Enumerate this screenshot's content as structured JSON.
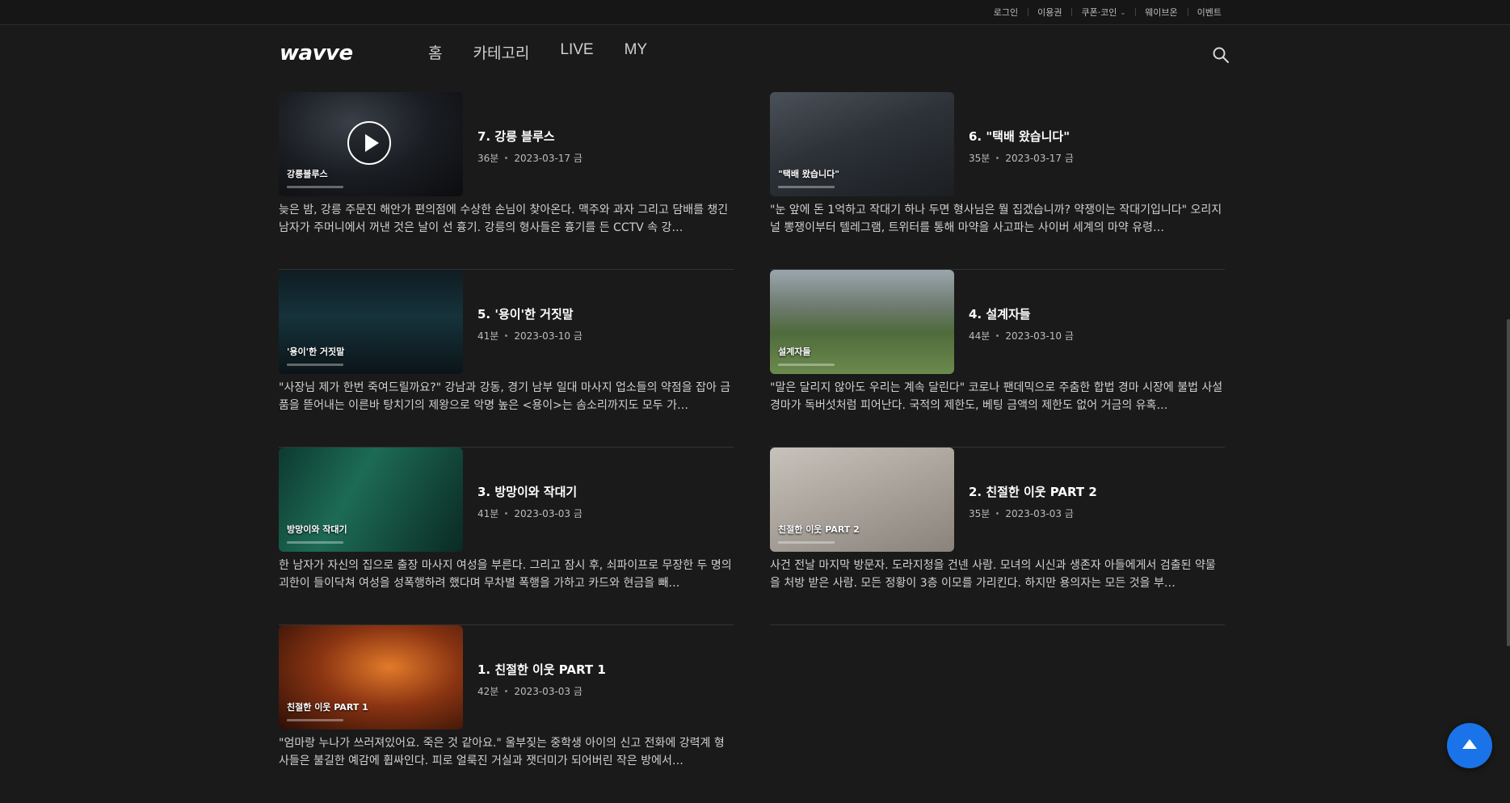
{
  "top_links": [
    {
      "label": "로그인"
    },
    {
      "label": "이용권"
    },
    {
      "label": "쿠폰·코인",
      "has_dropdown": true
    },
    {
      "label": "웨이브온"
    },
    {
      "label": "이벤트"
    }
  ],
  "brand": {
    "logo_text": "wavve"
  },
  "nav": {
    "items": [
      {
        "label": "홈"
      },
      {
        "label": "카테고리"
      },
      {
        "label": "LIVE"
      },
      {
        "label": "MY"
      }
    ]
  },
  "episodes": [
    {
      "title": "7. 강릉 블루스",
      "duration": "36분",
      "date": "2023-03-17 금",
      "thumb_caption": "강릉블루스",
      "thumb_bg": "bg-e7",
      "playing": true,
      "description": "늦은 밤, 강릉 주문진 해안가 편의점에 수상한 손님이 찾아온다. 맥주와 과자 그리고 담배를 챙긴 남자가 주머니에서 꺼낸 것은 날이 선 흉기. 강릉의 형사들은 흉기를 든 CCTV 속 강…"
    },
    {
      "title": "6. \"택배 왔습니다\"",
      "duration": "35분",
      "date": "2023-03-17 금",
      "thumb_caption": "\"택배 왔습니다\"",
      "thumb_bg": "bg-e6",
      "playing": false,
      "description": "\"눈 앞에 돈 1억하고 작대기 하나 두면 형사님은 뭘 집겠습니까? 약쟁이는 작대기입니다\" 오리지널 뽕쟁이부터 텔레그램, 트위터를 통해 마약을 사고파는 사이버 세계의 마약 유령…"
    },
    {
      "title": "5. '용이'한 거짓말",
      "duration": "41분",
      "date": "2023-03-10 금",
      "thumb_caption": "'용이'한 거짓말",
      "thumb_bg": "bg-e5",
      "playing": false,
      "description": "\"사장님 제가 한번 죽여드릴까요?\" 강남과 강동, 경기 남부 일대 마사지 업소들의 약점을 잡아 금품을 뜯어내는 이른바 탕치기의 제왕으로 악명 높은 <용이>는 솜소리까지도 모두 가…"
    },
    {
      "title": "4. 설계자들",
      "duration": "44분",
      "date": "2023-03-10 금",
      "thumb_caption": "설계자들",
      "thumb_bg": "bg-e4",
      "playing": false,
      "description": "\"말은 달리지 않아도 우리는 계속 달린다\" 코로나 팬데믹으로 주춤한 합법 경마 시장에 불법 사설 경마가 독버섯처럼 피어난다. 국적의 제한도, 베팅 금액의 제한도 없어 거금의 유혹…"
    },
    {
      "title": "3. 방망이와 작대기",
      "duration": "41분",
      "date": "2023-03-03 금",
      "thumb_caption": "방망이와 작대기",
      "thumb_bg": "bg-e3",
      "playing": false,
      "description": "한 남자가 자신의 집으로 출장 마사지 여성을 부른다. 그리고 잠시 후, 쇠파이프로 무장한 두 명의 괴한이 들이닥쳐 여성을 성폭행하려 했다며 무차별 폭행을 가하고 카드와 현금을 빼…"
    },
    {
      "title": "2. 친절한 이웃 PART 2",
      "duration": "35분",
      "date": "2023-03-03 금",
      "thumb_caption": "친절한 이웃 PART 2",
      "thumb_bg": "bg-e2",
      "playing": false,
      "description": "사건 전날 마지막 방문자. 도라지청을 건넨 사람. 모녀의 시신과 생존자 아들에게서 검출된 약물을 처방 받은 사람. 모든 정황이 3층 이모를 가리킨다. 하지만 용의자는 모든 것을 부…"
    },
    {
      "title": "1. 친절한 이웃 PART 1",
      "duration": "42분",
      "date": "2023-03-03 금",
      "thumb_caption": "친절한 이웃 PART 1",
      "thumb_bg": "bg-e1",
      "playing": false,
      "description": "\"엄마랑 누나가 쓰러져있어요. 죽은 것 같아요.\" 울부짖는 중학생 아이의 신고 전화에 강력계 형사들은 불길한 예감에 휩싸인다. 피로 얼룩진 거실과 잿더미가 되어버린 작은 방에서…"
    }
  ],
  "colors": {
    "background": "#1a1a1a",
    "accent": "#1a73e8"
  },
  "icons": {
    "search": "search-icon",
    "play": "play-icon",
    "scroll_top": "arrow-up-icon"
  }
}
